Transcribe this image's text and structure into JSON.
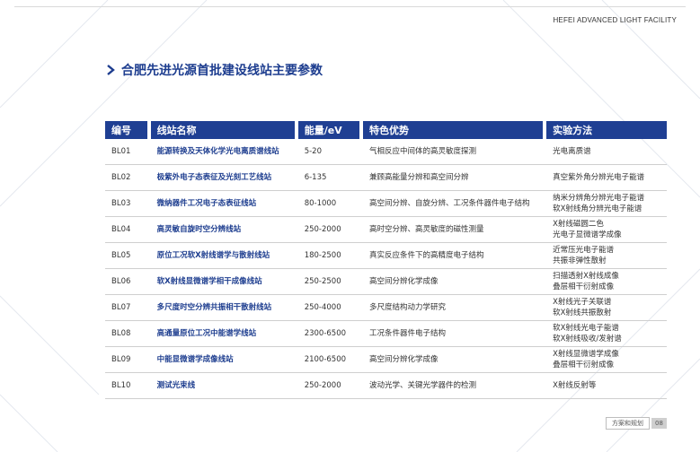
{
  "header": {
    "brand": "HEFEI ADVANCED LIGHT FACILITY"
  },
  "page": {
    "title": "合肥先进光源首批建设线站主要参数"
  },
  "table": {
    "columns": [
      "编号",
      "线站名称",
      "能量/eV",
      "特色优势",
      "实验方法"
    ],
    "rows": [
      {
        "id": "BL01",
        "name": "能源转换及天体化学光电离质谱线站",
        "energy": "5-20",
        "feature": "气相反应中间体的高灵敏度探测",
        "method": [
          "光电离质谱"
        ]
      },
      {
        "id": "BL02",
        "name": "极紫外电子态表征及光刻工艺线站",
        "energy": "6-135",
        "feature": "兼顾高能量分辨和高空间分辨",
        "method": [
          "真空紫外角分辨光电子能谱"
        ]
      },
      {
        "id": "BL03",
        "name": "微纳器件工况电子态表征线站",
        "energy": "80-1000",
        "feature": "高空间分辨、自旋分辨、工况条件器件电子结构",
        "method": [
          "纳米分辨角分辨光电子能谱",
          "软X射线角分辨光电子能谱"
        ]
      },
      {
        "id": "BL04",
        "name": "高灵敏自旋时空分辨线站",
        "energy": "250-2000",
        "feature": "高时空分辨、高灵敏度的磁性测量",
        "method": [
          "X射线磁圆二色",
          "光电子显微谱学成像"
        ]
      },
      {
        "id": "BL05",
        "name": "原位工况软X射线谱学与散射线站",
        "energy": "180-2500",
        "feature": "真实反应条件下的高精度电子结构",
        "method": [
          "近常压光电子能谱",
          "共振非弹性散射"
        ]
      },
      {
        "id": "BL06",
        "name": "软X射线显微谱学相干成像线站",
        "energy": "250-2500",
        "feature": "高空间分辨化学成像",
        "method": [
          "扫描透射X射线成像",
          "叠层相干衍射成像"
        ]
      },
      {
        "id": "BL07",
        "name": "多尺度时空分辨共振相干散射线站",
        "energy": "250-4000",
        "feature": "多尺度结构动力学研究",
        "method": [
          "X射线光子关联谱",
          "软X射线共振散射"
        ]
      },
      {
        "id": "BL08",
        "name": "高通量原位工况中能谱学线站",
        "energy": "2300-6500",
        "feature": "工况条件器件电子结构",
        "method": [
          "软X射线光电子能谱",
          "软X射线吸收/发射谱"
        ]
      },
      {
        "id": "BL09",
        "name": "中能显微谱学成像线站",
        "energy": "2100-6500",
        "feature": "高空间分辨化学成像",
        "method": [
          "X射线显微谱学成像",
          "叠层相干衍射成像"
        ]
      },
      {
        "id": "BL10",
        "name": "测试光束线",
        "energy": "250-2000",
        "feature": "波动光学、关键光学器件的检测",
        "method": [
          "X射线反射等"
        ]
      }
    ]
  },
  "footer": {
    "section": "方案和规划",
    "page_number": "08"
  },
  "colors": {
    "accent": "#1f3f93",
    "title": "#1d3d8f"
  }
}
